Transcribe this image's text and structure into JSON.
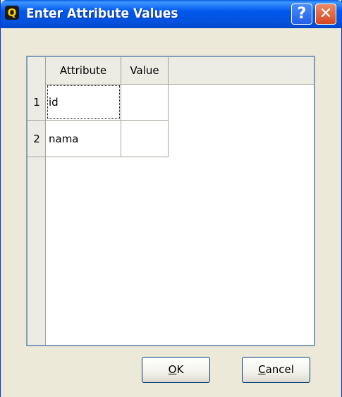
{
  "window": {
    "title": "Enter Attribute Values",
    "app_icon_glyph": "Q",
    "help_glyph": "?",
    "close_glyph": "✕"
  },
  "table": {
    "columns": [
      "Attribute",
      "Value"
    ],
    "rows": [
      {
        "number": "1",
        "attribute": "id",
        "value": ""
      },
      {
        "number": "2",
        "attribute": "nama",
        "value": ""
      }
    ]
  },
  "buttons": {
    "ok_mnemonic": "O",
    "ok_rest": "K",
    "cancel_mnemonic": "C",
    "cancel_rest": "ancel"
  }
}
